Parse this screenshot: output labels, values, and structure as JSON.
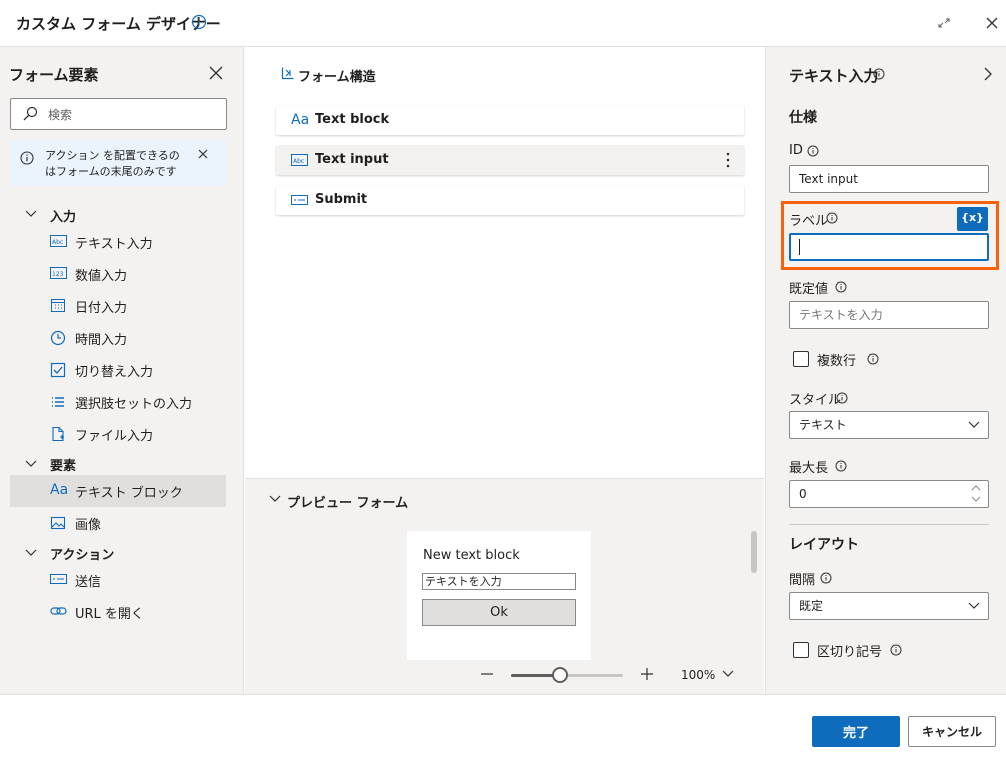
{
  "window": {
    "title": "カスタム フォーム デザイナー",
    "title_info_icon": "info-icon",
    "expand_icon": "expand-icon",
    "close_icon": "close-icon"
  },
  "left_panel": {
    "title": "フォーム要素",
    "search_placeholder": "検索",
    "notice_line1": "アクション を配置できるの",
    "notice_line2": "はフォームの末尾のみです",
    "groups": [
      {
        "label": "入力",
        "items": [
          {
            "label": "テキスト入力",
            "icon": "text-input-icon"
          },
          {
            "label": "数値入力",
            "icon": "number-input-icon"
          },
          {
            "label": "日付入力",
            "icon": "calendar-icon"
          },
          {
            "label": "時間入力",
            "icon": "clock-icon"
          },
          {
            "label": "切り替え入力",
            "icon": "checkbox-icon"
          },
          {
            "label": "選択肢セットの入力",
            "icon": "list-icon"
          },
          {
            "label": "ファイル入力",
            "icon": "file-icon"
          }
        ]
      },
      {
        "label": "要素",
        "items": [
          {
            "label": "テキスト ブロック",
            "icon": "text-block-icon",
            "selected": true
          },
          {
            "label": "画像",
            "icon": "image-icon"
          }
        ]
      },
      {
        "label": "アクション",
        "items": [
          {
            "label": "送信",
            "icon": "submit-icon"
          },
          {
            "label": "URL を開く",
            "icon": "link-icon"
          }
        ]
      }
    ]
  },
  "structure": {
    "title": "フォーム構造",
    "rows": [
      {
        "label": "Text block",
        "icon": "Aa"
      },
      {
        "label": "Text input",
        "icon": "Abc",
        "active": true
      },
      {
        "label": "Submit",
        "icon": "submit-icon"
      }
    ]
  },
  "preview": {
    "title": "プレビュー フォーム",
    "text_block": "New text block",
    "input_placeholder": "テキストを入力",
    "button_label": "Ok",
    "zoom_level": "100%",
    "zoom_fraction": 0.44
  },
  "properties": {
    "title": "テキスト入力",
    "section_spec": "仕様",
    "id_label": "ID",
    "id_value": "Text input",
    "label_label": "ラベル",
    "label_value": "",
    "var_button": "{x}",
    "default_label": "既定値",
    "default_placeholder": "テキストを入力",
    "multiline_label": "複数行",
    "multiline_checked": false,
    "style_label": "スタイル",
    "style_value": "テキスト",
    "maxlen_label": "最大長",
    "maxlen_value": "0",
    "section_layout": "レイアウト",
    "spacing_label": "間隔",
    "spacing_value": "既定",
    "separator_label": "区切り記号",
    "separator_checked": false
  },
  "footer": {
    "ok_label": "完了",
    "cancel_label": "キャンセル"
  },
  "colors": {
    "accent": "#0f6cbd",
    "highlight": "#f7630c"
  }
}
